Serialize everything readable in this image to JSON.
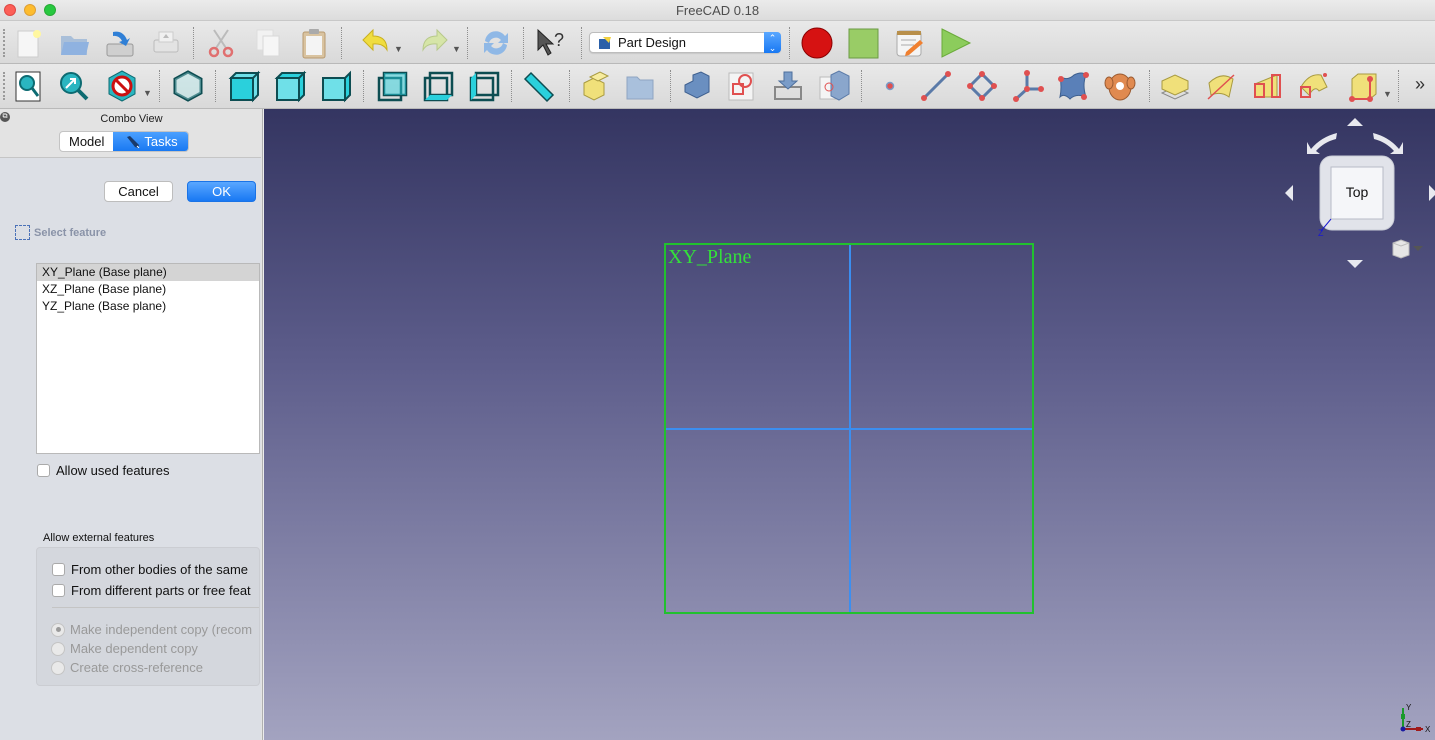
{
  "window": {
    "title": "FreeCAD 0.18"
  },
  "toolbar_main": {
    "buttons": [
      {
        "name": "new-document",
        "icon": "new-document-icon"
      },
      {
        "name": "open-document",
        "icon": "open-folder-icon"
      },
      {
        "name": "save-document",
        "icon": "save-icon"
      },
      {
        "name": "print-document",
        "icon": "print-icon"
      },
      {
        "name": "cut",
        "icon": "scissors-icon"
      },
      {
        "name": "copy",
        "icon": "copy-icon"
      },
      {
        "name": "paste",
        "icon": "clipboard-icon"
      },
      {
        "name": "undo",
        "icon": "undo-icon"
      },
      {
        "name": "redo",
        "icon": "redo-icon"
      },
      {
        "name": "refresh",
        "icon": "refresh-icon"
      },
      {
        "name": "whats-this",
        "icon": "whats-this-icon"
      }
    ],
    "workbench": {
      "label": "Part Design",
      "icon": "part-design-icon"
    },
    "macro_buttons": [
      {
        "name": "macro-record",
        "icon": "record-icon"
      },
      {
        "name": "macro-stop",
        "icon": "stop-icon"
      },
      {
        "name": "macro-edit",
        "icon": "notepad-pencil-icon"
      },
      {
        "name": "macro-run",
        "icon": "play-icon"
      }
    ]
  },
  "toolbar_view": {
    "buttons": [
      {
        "name": "fit-all",
        "icon": "fit-all-icon"
      },
      {
        "name": "fit-selection",
        "icon": "fit-selection-icon"
      },
      {
        "name": "draw-style",
        "icon": "draw-style-icon"
      },
      {
        "name": "view-isometric",
        "icon": "isometric-cube-icon"
      },
      {
        "name": "view-front",
        "icon": "front-cube-icon"
      },
      {
        "name": "view-top",
        "icon": "top-cube-icon"
      },
      {
        "name": "view-right",
        "icon": "right-cube-icon"
      },
      {
        "name": "view-rear",
        "icon": "rear-cube-icon"
      },
      {
        "name": "view-bottom",
        "icon": "bottom-cube-icon"
      },
      {
        "name": "view-left",
        "icon": "left-cube-icon"
      },
      {
        "name": "measure-distance",
        "icon": "ruler-icon"
      },
      {
        "name": "create-body",
        "icon": "body-icon"
      },
      {
        "name": "create-part",
        "icon": "folder-icon"
      },
      {
        "name": "create-shapebinder",
        "icon": "shapebinder-icon"
      },
      {
        "name": "create-sketch",
        "icon": "sketch-icon"
      },
      {
        "name": "clone",
        "icon": "clone-import-icon"
      },
      {
        "name": "sub-shape-binder",
        "icon": "sub-shape-binder-icon"
      },
      {
        "name": "datum-point",
        "icon": "datum-point-icon"
      },
      {
        "name": "datum-line",
        "icon": "datum-line-icon"
      },
      {
        "name": "datum-plane",
        "icon": "datum-plane-icon"
      },
      {
        "name": "local-coordinate-system",
        "icon": "lcs-icon"
      },
      {
        "name": "shape-binder",
        "icon": "binder-surface-icon"
      },
      {
        "name": "validate-sketch",
        "icon": "sheep-icon"
      },
      {
        "name": "pad",
        "icon": "pad-icon"
      },
      {
        "name": "revolution",
        "icon": "revolution-icon"
      },
      {
        "name": "additive-loft",
        "icon": "loft-icon"
      },
      {
        "name": "additive-pipe",
        "icon": "pipe-icon"
      },
      {
        "name": "additive-primitive",
        "icon": "additive-box-icon"
      }
    ],
    "overflow": "»"
  },
  "combo_view": {
    "title": "Combo View",
    "tabs": [
      {
        "label": "Model",
        "active": false
      },
      {
        "label": "Tasks",
        "active": true
      }
    ],
    "cancel_label": "Cancel",
    "ok_label": "OK",
    "select_feature_label": "Select feature",
    "features": [
      {
        "label": "XY_Plane (Base plane)",
        "selected": true
      },
      {
        "label": "XZ_Plane (Base plane)",
        "selected": false
      },
      {
        "label": "YZ_Plane (Base plane)",
        "selected": false
      }
    ],
    "allow_used_features": {
      "label": "Allow used features",
      "checked": false
    },
    "external_group_label": "Allow external features",
    "from_other_bodies": {
      "label": "From other bodies of the same",
      "checked": false
    },
    "from_different_parts": {
      "label": "From different parts or free feat",
      "checked": false
    },
    "copy_options": [
      {
        "label": "Make independent copy (recom",
        "selected": true,
        "enabled": false
      },
      {
        "label": "Make dependent copy",
        "selected": false,
        "enabled": false
      },
      {
        "label": "Create cross-reference",
        "selected": false,
        "enabled": false
      }
    ]
  },
  "viewport": {
    "plane_label": "XY_Plane",
    "navcube_face": "Top",
    "navcube_axis": "Z",
    "axis_labels": {
      "x": "X",
      "y": "Y",
      "z": "Z"
    },
    "colors": {
      "plane_border": "#21c12e",
      "plane_grid": "#3b8ef0",
      "plane_label": "#34e03a",
      "bg_top": "#343561",
      "bg_bottom": "#a3a3c0"
    }
  }
}
